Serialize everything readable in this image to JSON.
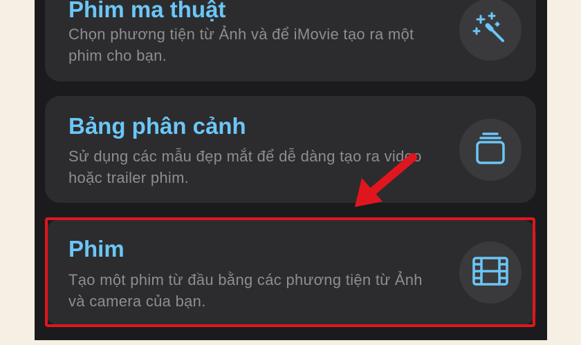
{
  "cards": [
    {
      "title": "Phim ma thuật",
      "description": "Chọn phương tiện từ Ảnh và để iMovie tạo ra một phim cho bạn.",
      "icon": "magic-wand-icon"
    },
    {
      "title": "Bảng phân cảnh",
      "description": "Sử dụng các mẫu đẹp mắt để dễ dàng tạo ra video hoặc trailer phim.",
      "icon": "storyboard-stack-icon"
    },
    {
      "title": "Phim",
      "description": "Tạo một phim từ đầu bằng các phương tiện từ Ảnh và camera của bạn.",
      "icon": "film-strip-icon"
    }
  ],
  "colors": {
    "accent": "#6cc6f6",
    "highlight": "#e0161f",
    "card_background": "#2c2c2e",
    "page_background": "#1b1b1d"
  }
}
